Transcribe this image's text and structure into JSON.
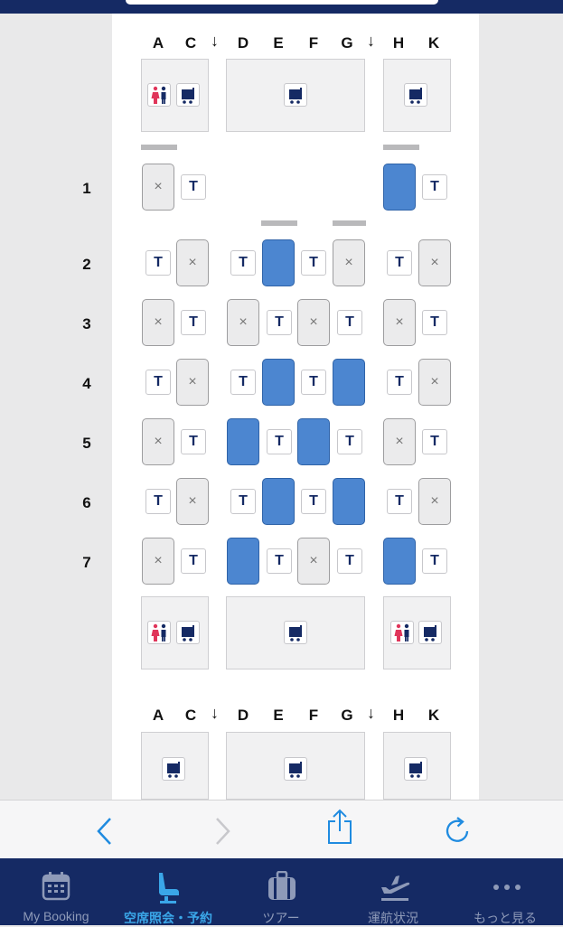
{
  "colors": {
    "available_seat": "#4c86d0",
    "occupied_seat": "#ebebec",
    "navy": "#152a64",
    "active_tab": "#3aa6e8",
    "toolbar_icon": "#1f8be0"
  },
  "seatmap": {
    "top_header": {
      "A": "A",
      "C": "C",
      "D": "D",
      "E": "E",
      "F": "F",
      "G": "G",
      "H": "H",
      "K": "K"
    },
    "bottom_header": {
      "A": "A",
      "C": "C",
      "D": "D",
      "E": "E",
      "F": "F",
      "G": "G",
      "H": "H",
      "K": "K"
    },
    "aisle_arrow": "↓",
    "seat_x": "×",
    "t_label": "T",
    "rows": [
      "1",
      "2",
      "3",
      "4",
      "5",
      "6",
      "7"
    ],
    "legend": {
      "T": "T",
      "seat_status": {
        "available": "blue",
        "occupied": "grey with ×"
      }
    },
    "seat_status_by_row": {
      "1": {
        "A": "occupied",
        "K": "available"
      },
      "2": {
        "A": "occupied",
        "D": "available",
        "F": "occupied",
        "H": "occupied"
      },
      "3": {
        "A": "occupied",
        "D": "occupied",
        "F": "occupied",
        "H": "occupied"
      },
      "4": {
        "A": "occupied",
        "D": "available",
        "F": "available",
        "H": "occupied"
      },
      "5": {
        "A": "occupied",
        "D": "available",
        "F": "available",
        "H": "occupied"
      },
      "6": {
        "A": "occupied",
        "D": "available",
        "F": "available",
        "H": "occupied"
      },
      "7": {
        "A": "occupied",
        "D": "available",
        "F": "occupied",
        "H": "available"
      }
    }
  },
  "browser_toolbar": {
    "back": "back-chevron-icon",
    "forward": "forward-chevron-icon",
    "share": "share-icon",
    "reload": "reload-icon"
  },
  "tabbar": {
    "tabs": [
      {
        "label": "My Booking",
        "icon": "calendar-icon",
        "active": false
      },
      {
        "label": "空席照会・予約",
        "icon": "seat-icon",
        "active": true
      },
      {
        "label": "ツアー",
        "icon": "suitcase-icon",
        "active": false
      },
      {
        "label": "運航状況",
        "icon": "plane-departure-icon",
        "active": false
      },
      {
        "label": "もっと見る",
        "icon": "more-dots-icon",
        "active": false
      }
    ]
  }
}
